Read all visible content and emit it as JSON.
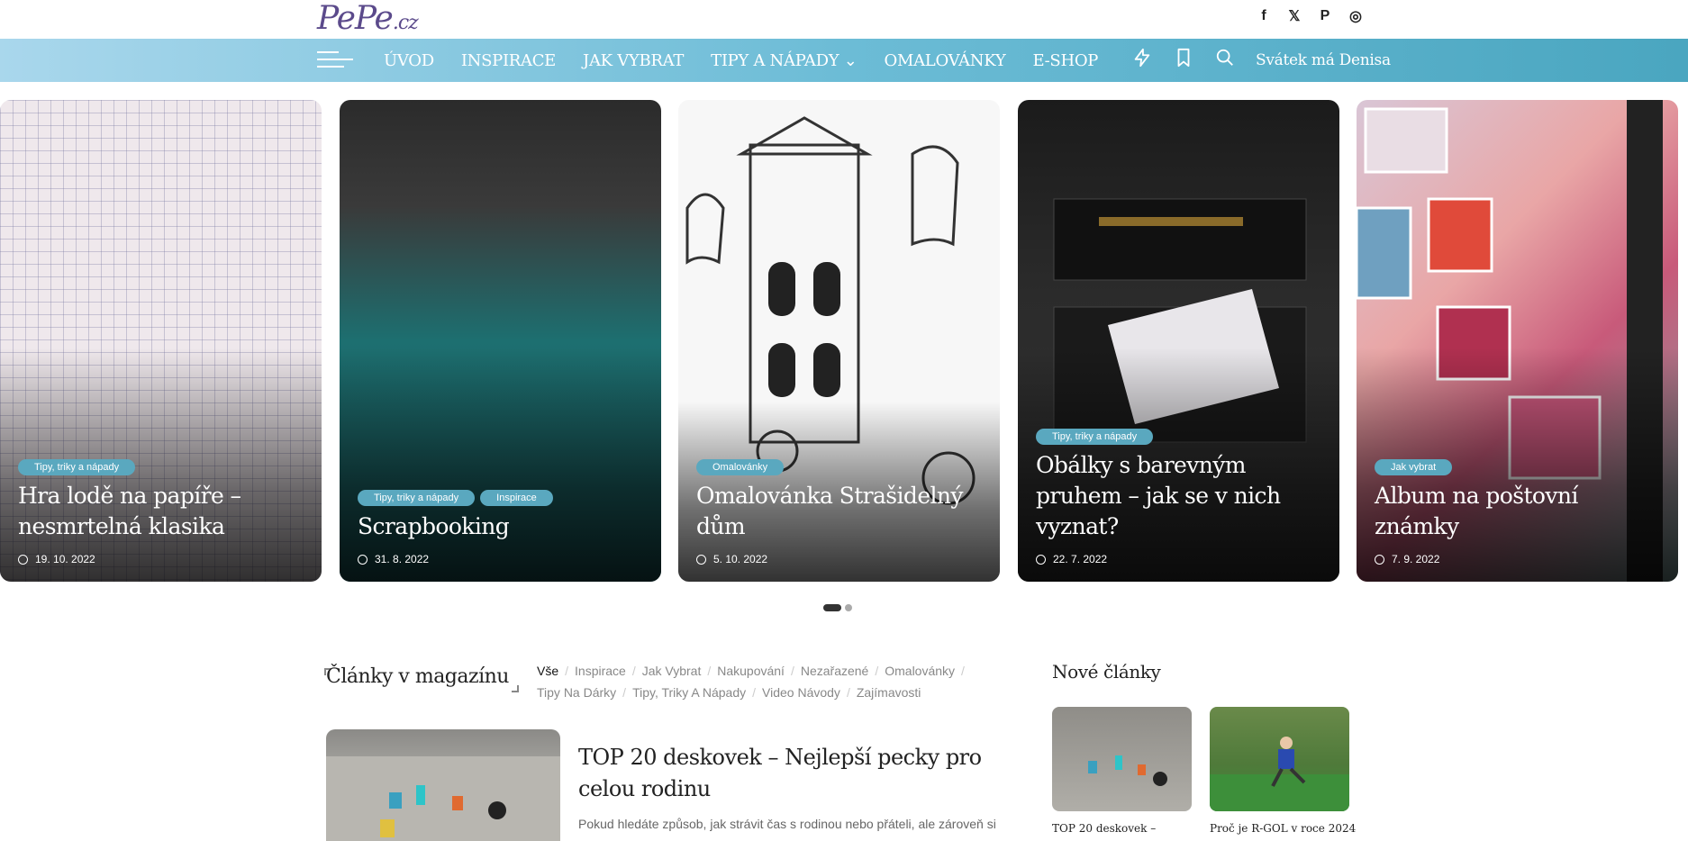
{
  "brand": {
    "logo": "PePe",
    "logo_tld": ".cz"
  },
  "social": {
    "facebook": "f",
    "x": "𝕏",
    "pinterest": "P",
    "instagram": "◎"
  },
  "nav": {
    "items": [
      "ÚVOD",
      "INSPIRACE",
      "JAK VYBRAT",
      "TIPY A NÁPADY ⌄",
      "OMALOVÁNKY",
      "E-SHOP"
    ],
    "holiday": "Svátek má Denisa"
  },
  "slider": {
    "cards": [
      {
        "tags": [
          "Tipy, triky a nápady"
        ],
        "title": "Hra lodě na papíře – nesmrtelná klasika",
        "date": "19. 10. 2022"
      },
      {
        "tags": [
          "Tipy, triky a nápady",
          "Inspirace"
        ],
        "title": "Scrapbooking",
        "date": "31. 8. 2022"
      },
      {
        "tags": [
          "Omalovánky"
        ],
        "title": "Omalovánka Strašidelný dům",
        "date": "5. 10. 2022"
      },
      {
        "tags": [
          "Tipy, triky a nápady"
        ],
        "title": "Obálky s barevným pruhem – jak se v nich vyznat?",
        "date": "22. 7. 2022"
      },
      {
        "tags": [
          "Jak vybrat"
        ],
        "title": "Album na poštovní známky",
        "date": "7. 9. 2022"
      }
    ]
  },
  "magazine": {
    "title": "Články v magazínu",
    "filters": [
      "Vše",
      "Inspirace",
      "Jak Vybrat",
      "Nakupování",
      "Nezařazené",
      "Omalovánky",
      "Tipy Na Dárky",
      "Tipy, Triky A Nápady",
      "Video Návody",
      "Zajímavosti"
    ],
    "article": {
      "title": "TOP 20 deskovek – Nejlepší pecky pro celou rodinu",
      "excerpt": "Pokud hledáte způsob, jak strávit čas s rodinou nebo přáteli, ale zároveň si"
    }
  },
  "sidebar": {
    "title": "Nové články",
    "items": [
      {
        "caption": "TOP 20 deskovek –"
      },
      {
        "caption": "Proč je R-GOL v roce 2024"
      }
    ]
  },
  "colors": {
    "nav_start": "#a9d7ec",
    "nav_end": "#4aa6c0",
    "tag": "#5aa8bf",
    "logo": "#5b4a8b"
  }
}
